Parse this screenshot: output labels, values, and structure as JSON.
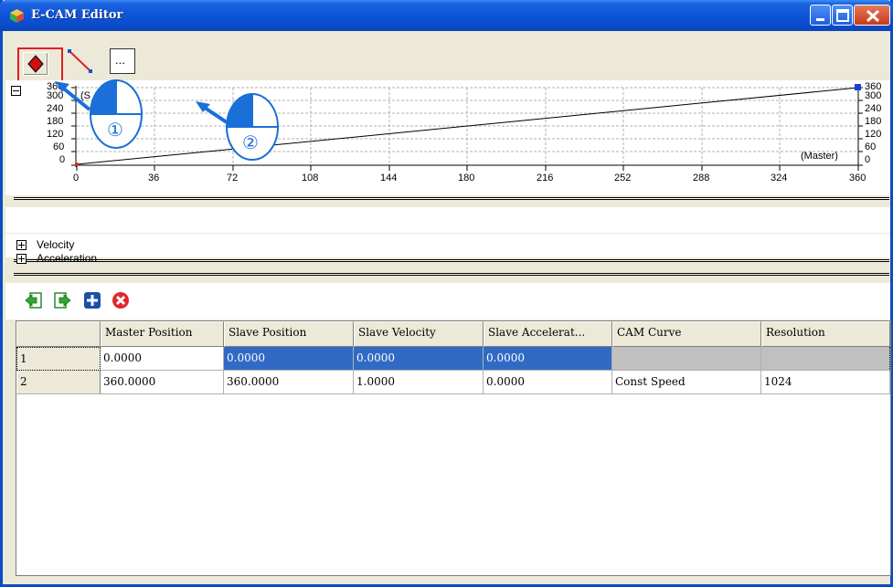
{
  "window": {
    "title": "E-CAM Editor"
  },
  "toolbar": {
    "point_tool": "point-tool",
    "line_tool": "line-tool",
    "more_label": "..."
  },
  "chart": {
    "y_ticks": [
      "360",
      "300",
      "240",
      "180",
      "120",
      "60",
      "0"
    ],
    "x_ticks": [
      "0",
      "36",
      "72",
      "108",
      "144",
      "180",
      "216",
      "252",
      "288",
      "324",
      "360"
    ],
    "y_axis_label_fragment": "(S",
    "x_axis_label": "(Master)"
  },
  "annotations": {
    "step1": "①",
    "step2": "②"
  },
  "sections": {
    "velocity": "Velocity",
    "acceleration": "Acceleration"
  },
  "table": {
    "columns": [
      "",
      "Master Position",
      "Slave Position",
      "Slave Velocity",
      "Slave Accelerat...",
      "CAM Curve",
      "Resolution"
    ],
    "rows": [
      [
        "1",
        "0.0000",
        "0.0000",
        "0.0000",
        "0.0000",
        "",
        ""
      ],
      [
        "2",
        "360.0000",
        "360.0000",
        "1.0000",
        "0.0000",
        "Const Speed",
        "1024"
      ]
    ]
  },
  "colors": {
    "title_bar": "#0a54d8",
    "selection": "#316ac5",
    "highlight_box": "#e02020",
    "annotation_blue": "#1a6fd8"
  }
}
